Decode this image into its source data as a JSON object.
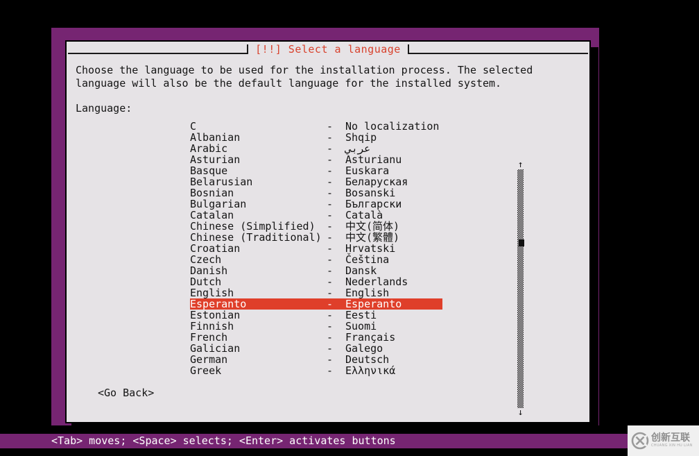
{
  "screen": {
    "backdrop_color": "#762572",
    "dialog_bg_color": "#e6e3e6",
    "accent_color": "#df3f2a",
    "title_color": "#d8412c"
  },
  "dialog": {
    "title": "[!!] Select a language",
    "intro_text": "Choose the language to be used for the installation process. The selected language will also be the default language for the installed system.",
    "field_label": "Language:",
    "go_back_label": "<Go Back>"
  },
  "language_list": {
    "separator": "-",
    "selected_index": 16,
    "items": [
      {
        "name": "C",
        "native": "No localization"
      },
      {
        "name": "Albanian",
        "native": "Shqip"
      },
      {
        "name": "Arabic",
        "native": "عربي"
      },
      {
        "name": "Asturian",
        "native": "Asturianu"
      },
      {
        "name": "Basque",
        "native": "Euskara"
      },
      {
        "name": "Belarusian",
        "native": "Беларуская"
      },
      {
        "name": "Bosnian",
        "native": "Bosanski"
      },
      {
        "name": "Bulgarian",
        "native": "Български"
      },
      {
        "name": "Catalan",
        "native": "Català"
      },
      {
        "name": "Chinese (Simplified)",
        "native": "中文(简体)"
      },
      {
        "name": "Chinese (Traditional)",
        "native": "中文(繁體)"
      },
      {
        "name": "Croatian",
        "native": "Hrvatski"
      },
      {
        "name": "Czech",
        "native": "Čeština"
      },
      {
        "name": "Danish",
        "native": "Dansk"
      },
      {
        "name": "Dutch",
        "native": "Nederlands"
      },
      {
        "name": "English",
        "native": "English"
      },
      {
        "name": "Esperanto",
        "native": "Esperanto"
      },
      {
        "name": "Estonian",
        "native": "Eesti"
      },
      {
        "name": "Finnish",
        "native": "Suomi"
      },
      {
        "name": "French",
        "native": "Français"
      },
      {
        "name": "Galician",
        "native": "Galego"
      },
      {
        "name": "German",
        "native": "Deutsch"
      },
      {
        "name": "Greek",
        "native": "Ελληνικά"
      }
    ]
  },
  "scrollbar": {
    "up_arrow": "↑",
    "down_arrow": "↓"
  },
  "status_bar": {
    "text": "<Tab> moves; <Space> selects; <Enter> activates buttons"
  },
  "watermark": {
    "chinese": "创新互联",
    "pinyin": "CHUANG XIN HU LIAN"
  }
}
